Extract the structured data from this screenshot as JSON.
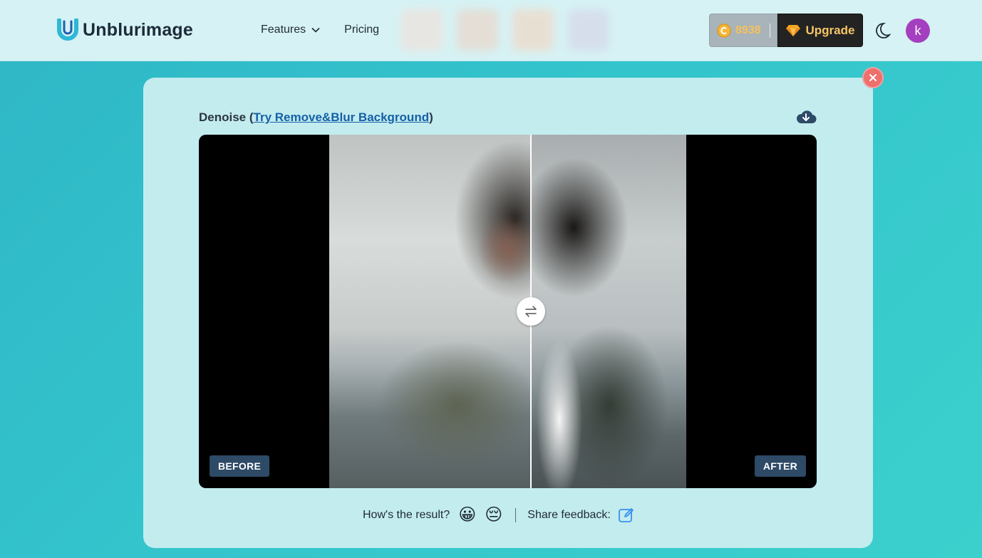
{
  "header": {
    "logo_text": "Unblurimage",
    "nav": [
      {
        "label": "Features",
        "has_dropdown": true
      },
      {
        "label": "Pricing",
        "has_dropdown": false
      }
    ],
    "credits": "8938",
    "upgrade_label": "Upgrade",
    "avatar_letter": "k"
  },
  "panel": {
    "title_prefix": "Denoise (",
    "title_link": "Try Remove&Blur Background",
    "title_suffix": ")",
    "before_label": "BEFORE",
    "after_label": "AFTER"
  },
  "feedback": {
    "question": "How's the result?",
    "positive_emoji": "😀",
    "negative_emoji": "😔",
    "share_label": "Share feedback:"
  },
  "colors": {
    "background": "#33c3cc",
    "header_bg": "#d6f2f4",
    "card_bg": "#c3ecef",
    "upgrade_bg": "#232323",
    "upgrade_text": "#f6c566",
    "avatar_bg": "#a43fbf",
    "link": "#1560a8",
    "tag_bg": "#2d4a66",
    "close_bg": "#ef6f6c"
  }
}
